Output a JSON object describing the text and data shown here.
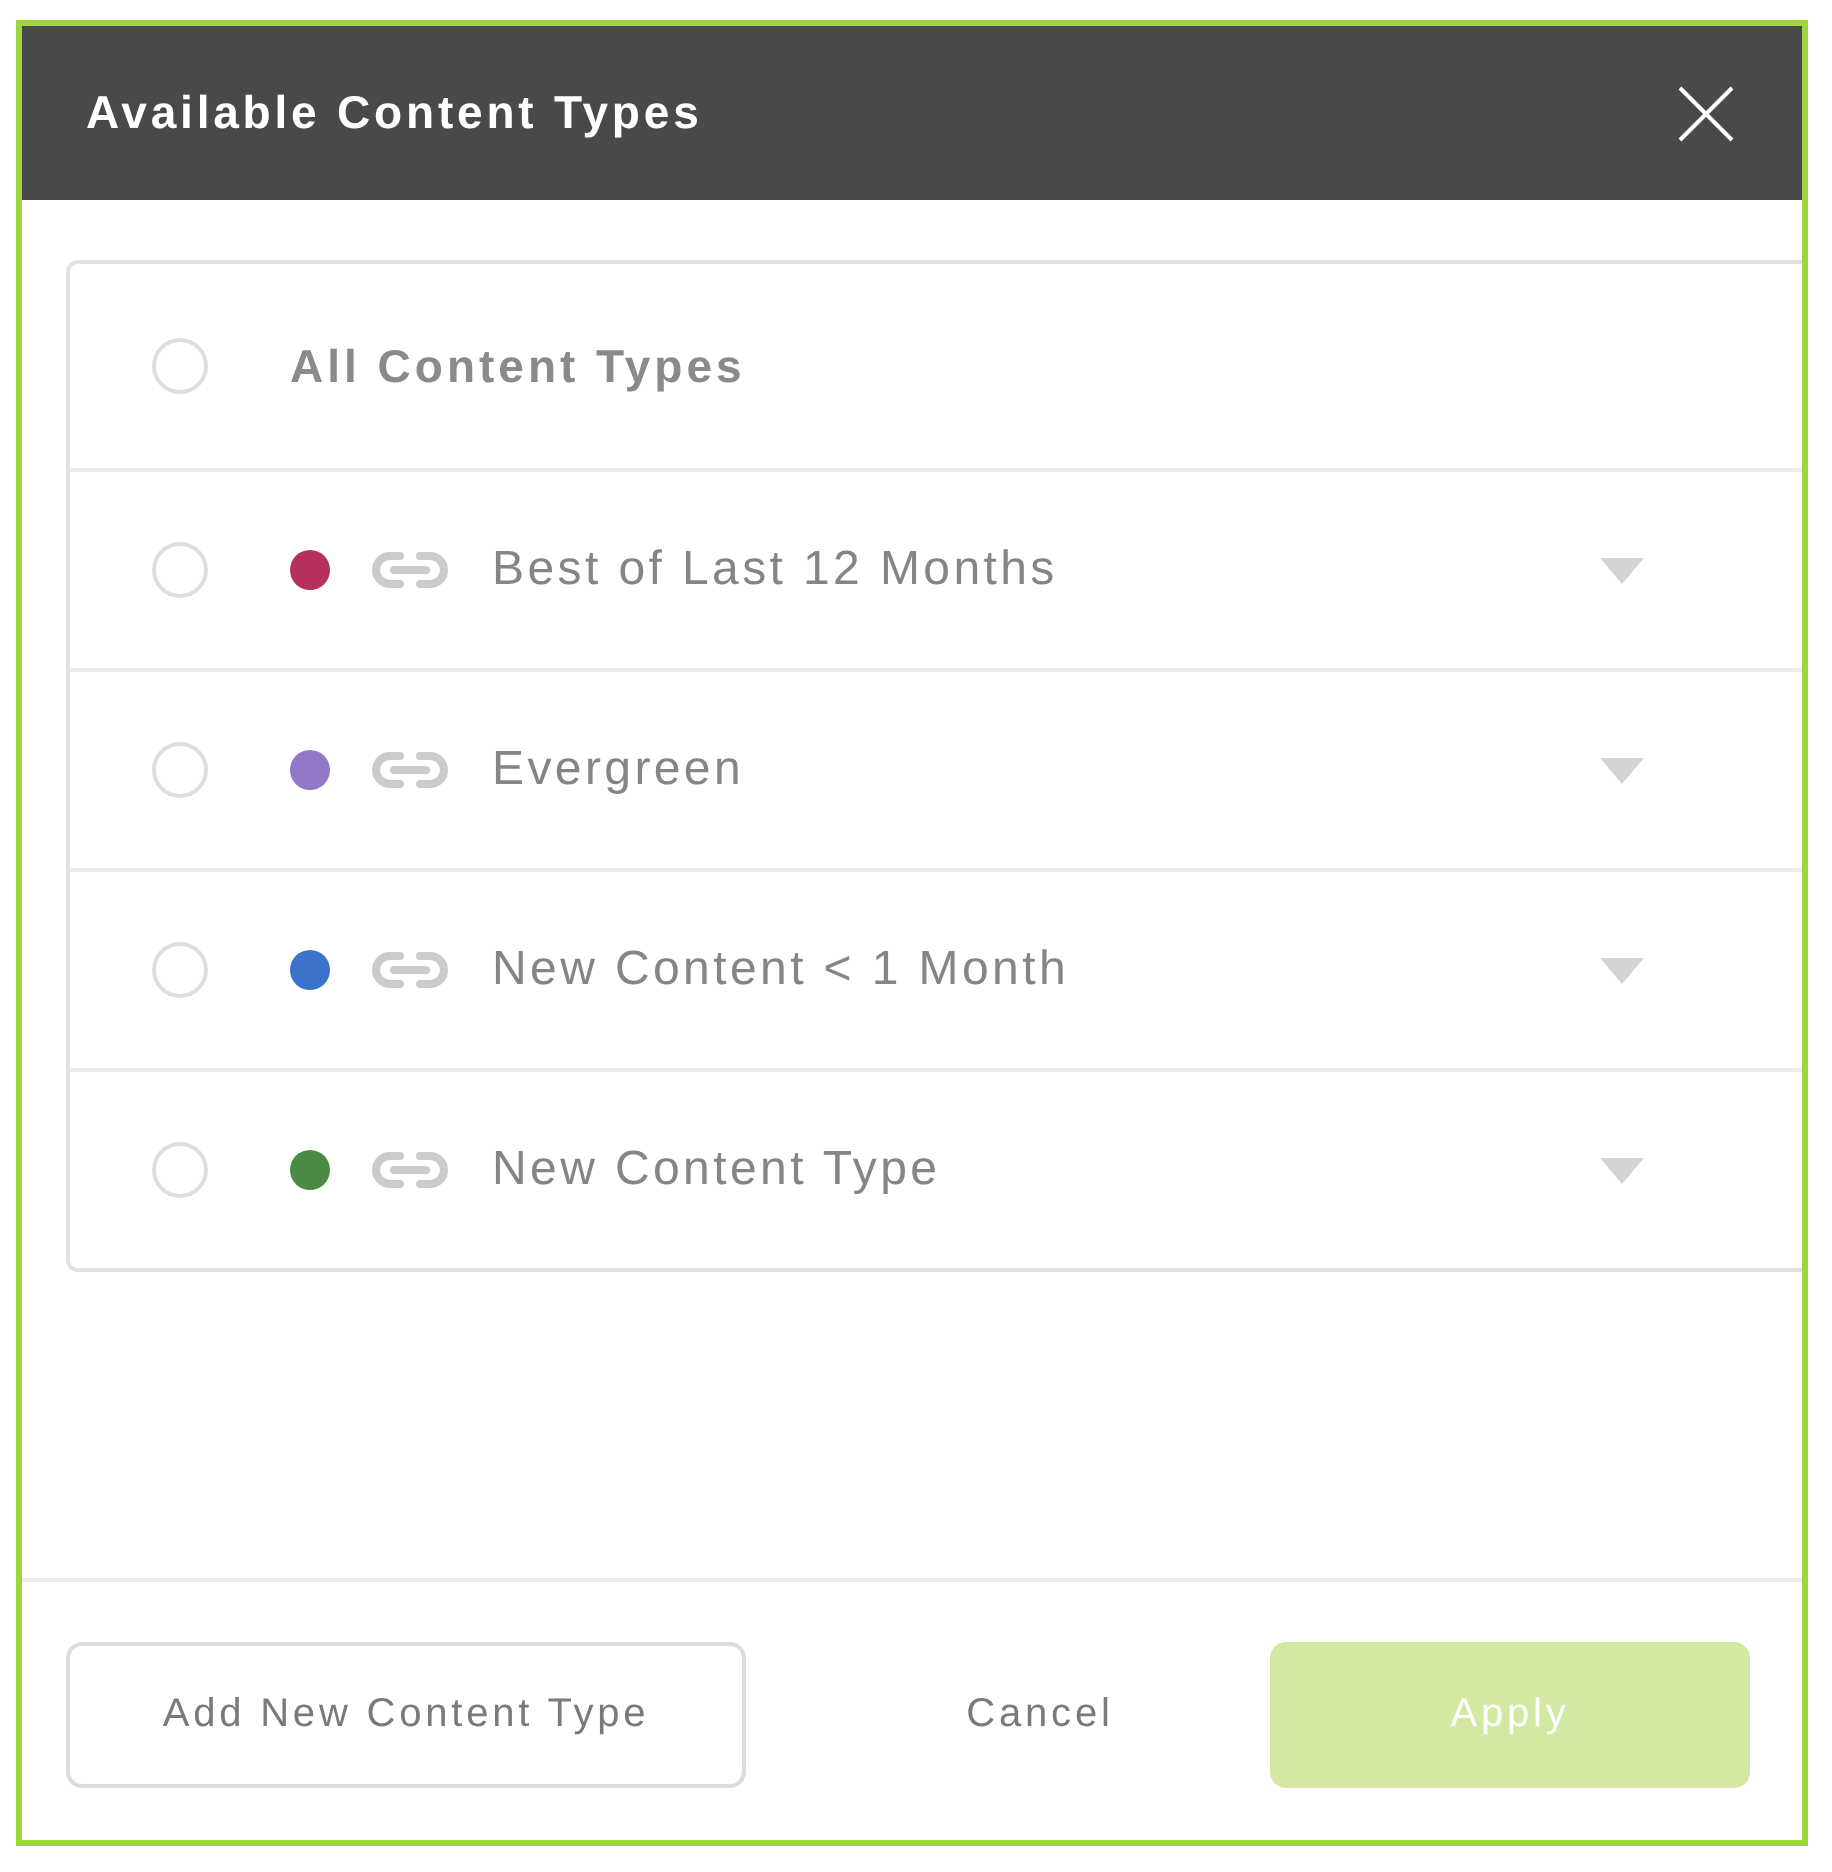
{
  "dialog": {
    "title": "Available Content Types"
  },
  "list": {
    "header": {
      "label": "All Content Types",
      "selected": false
    },
    "items": [
      {
        "label": "Best of Last 12 Months",
        "color": "#b5305a",
        "selected": false
      },
      {
        "label": "Evergreen",
        "color": "#9377c8",
        "selected": false
      },
      {
        "label": "New Content < 1 Month",
        "color": "#3a72cc",
        "selected": false
      },
      {
        "label": "New Content Type",
        "color": "#4a8a45",
        "selected": false
      }
    ]
  },
  "footer": {
    "buttons": [
      {
        "kind": "outline",
        "label": "Add New Content Type",
        "disabled": false
      },
      {
        "kind": "text",
        "label": "Cancel",
        "disabled": false
      },
      {
        "kind": "primary",
        "label": "Apply",
        "disabled": true
      }
    ]
  }
}
